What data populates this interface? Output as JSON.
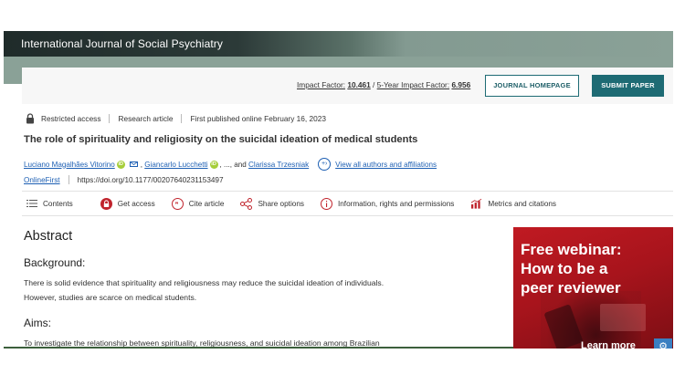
{
  "journal": {
    "name": "International Journal of Social Psychiatry"
  },
  "metrics": {
    "impact_label": "Impact Factor:",
    "impact_value": "10.461",
    "five_year_label": "5-Year Impact Factor:",
    "five_year_value": "6.956",
    "sep": " / "
  },
  "buttons": {
    "journal_homepage": "JOURNAL HOMEPAGE",
    "submit_paper": "SUBMIT PAPER"
  },
  "meta": {
    "access": "Restricted access",
    "type": "Research article",
    "published": "First published online February 16, 2023"
  },
  "article": {
    "title": "The role of spirituality and religiosity on the suicidal ideation of medical students",
    "authors": [
      "Luciano Magalhães Vitorino",
      "Giancarlo Lucchetti",
      "Clarissa Trzesniak"
    ],
    "ellipsis": ", ..., and",
    "comma": ",",
    "view_all": "View all authors and affiliations",
    "online_first": "OnlineFirst",
    "doi": "https://doi.org/10.1177/00207640231153497"
  },
  "toolbar": {
    "contents": "Contents",
    "get_access": "Get access",
    "cite": "Cite article",
    "share": "Share options",
    "info": "Information, rights and permissions",
    "metrics": "Metrics and citations"
  },
  "abstract": {
    "heading": "Abstract",
    "background_heading": "Background:",
    "background_line1": "There is solid evidence that spirituality and religiousness may reduce the suicidal ideation of individuals.",
    "background_line2": "However, studies are scarce on medical students.",
    "aims_heading": "Aims:",
    "aims_line1": "To investigate the relationship between spirituality, religiousness, and suicidal ideation among Brazilian"
  },
  "ad": {
    "line1": "Free webinar:",
    "line2": "How to be a",
    "line3": "peer reviewer",
    "more": "Learn more"
  },
  "colors": {
    "accent": "#1e6b74",
    "link": "#1d5fb3",
    "ad_red": "#c01a22",
    "banner_gray": "#8aa197"
  }
}
